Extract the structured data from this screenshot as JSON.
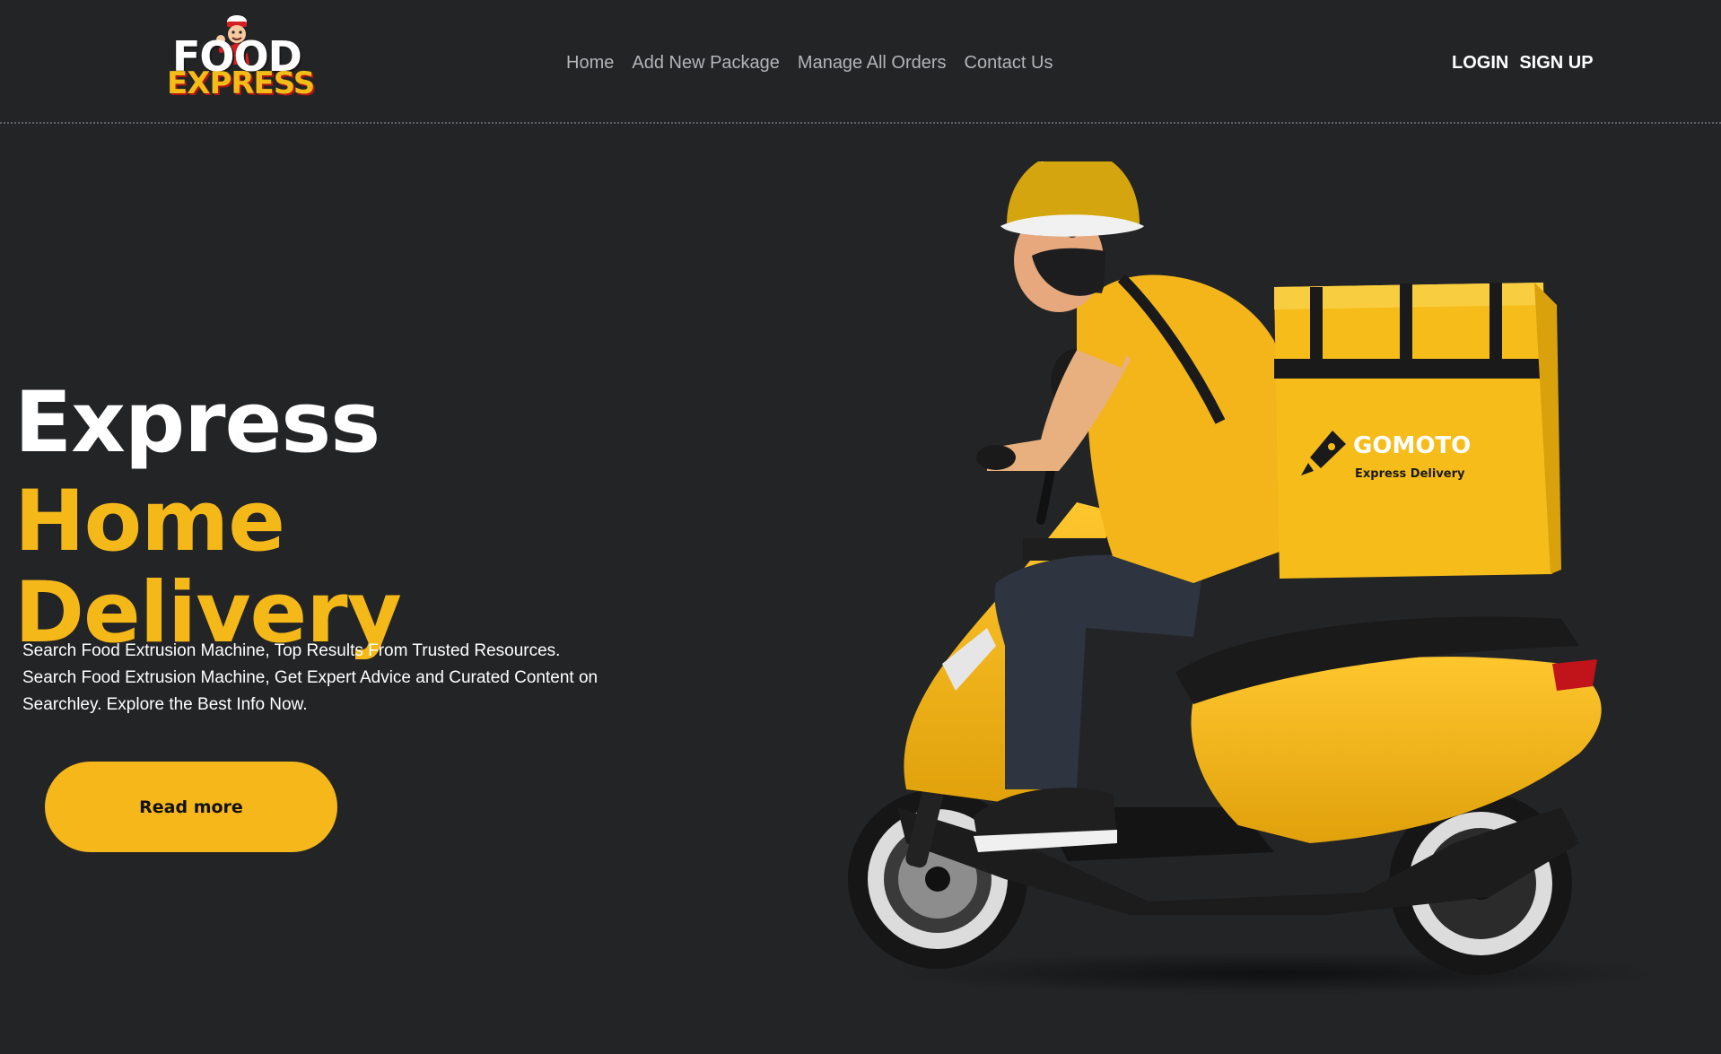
{
  "brand": {
    "logo_top": "FOOD",
    "logo_bottom": "EXPRESS"
  },
  "nav": {
    "items": [
      {
        "label": "Home"
      },
      {
        "label": "Add New Package"
      },
      {
        "label": "Manage All Orders"
      },
      {
        "label": "Contact Us"
      }
    ]
  },
  "auth": {
    "login_label": "LOGIN",
    "signup_label": "SIGN UP"
  },
  "hero": {
    "line1": "Express",
    "line2": "Home",
    "line3": "Delivery",
    "description": "Search Food Extrusion Machine, Top Results From Trusted Resources. Search Food Extrusion Machine, Get Expert Advice and Curated Content on Searchley. Explore the Best Info Now.",
    "button_label": "Read more"
  },
  "illustration": {
    "bag_brand": "GOMOTO",
    "bag_tagline": "Express Delivery"
  },
  "colors": {
    "background": "#232426",
    "accent": "#f5b819",
    "nav_text": "#b4b5b8"
  }
}
